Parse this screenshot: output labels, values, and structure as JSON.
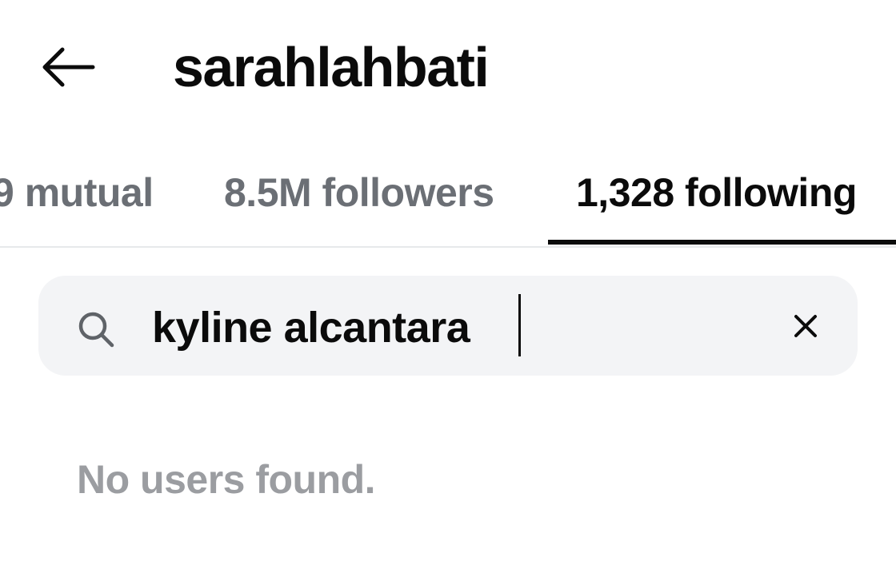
{
  "header": {
    "back_icon": "arrow-left-icon",
    "title": "sarahlahbati"
  },
  "tabs": [
    {
      "label": "9 mutual",
      "active": false
    },
    {
      "label": "8.5M followers",
      "active": false
    },
    {
      "label": "1,328 following",
      "active": true
    }
  ],
  "search": {
    "icon": "search-icon",
    "value": "kyline alcantara",
    "clear_icon": "close-icon"
  },
  "results": {
    "empty_message": "No users found."
  },
  "colors": {
    "text_primary": "#0b0b0b",
    "text_secondary": "#6b6f75",
    "text_muted": "#9b9da1",
    "search_background": "#f3f4f6",
    "divider": "#e7e9eb"
  }
}
